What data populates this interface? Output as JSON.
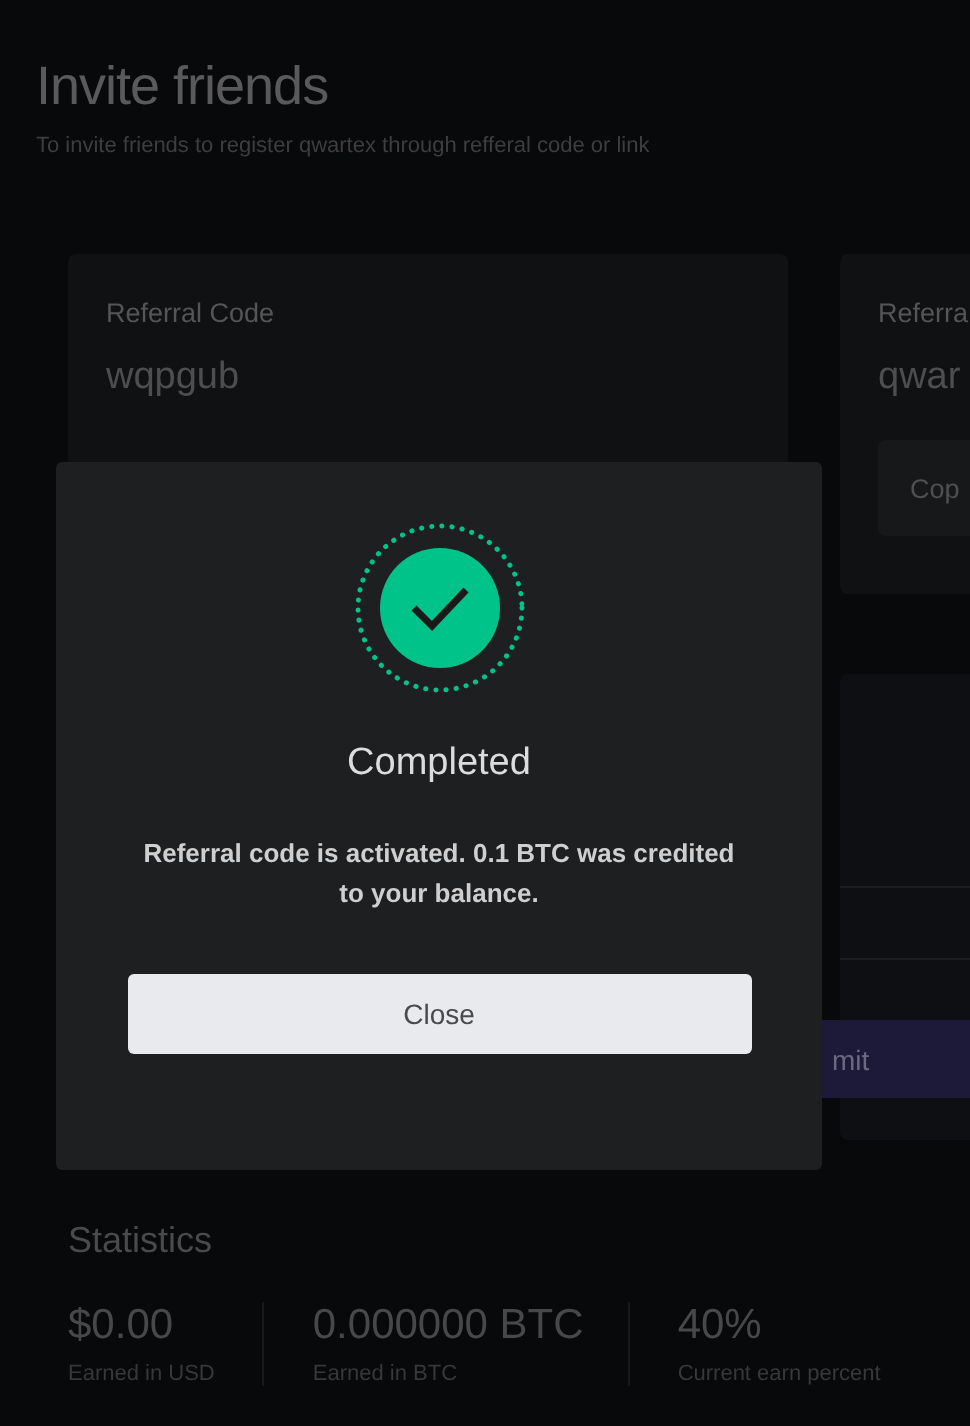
{
  "page": {
    "title": "Invite friends",
    "subtitle": "To invite friends to register qwartex through refferal code or link"
  },
  "cards": [
    {
      "label": "Referral Code",
      "value": "wqpgub"
    },
    {
      "label": "Referra",
      "value": "qwar",
      "button": "Cop"
    }
  ],
  "form": {
    "submit_button": "mit"
  },
  "statistics": {
    "title": "Statistics",
    "items": [
      {
        "value": "$0.00",
        "label": "Earned in USD"
      },
      {
        "value": "0.000000 BTC",
        "label": "Earned in BTC"
      },
      {
        "value": "40%",
        "label": "Current earn percent"
      }
    ]
  },
  "modal": {
    "title": "Completed",
    "message": "Referral code is activated. 0.1 BTC was credited to your balance.",
    "button": "Close"
  }
}
